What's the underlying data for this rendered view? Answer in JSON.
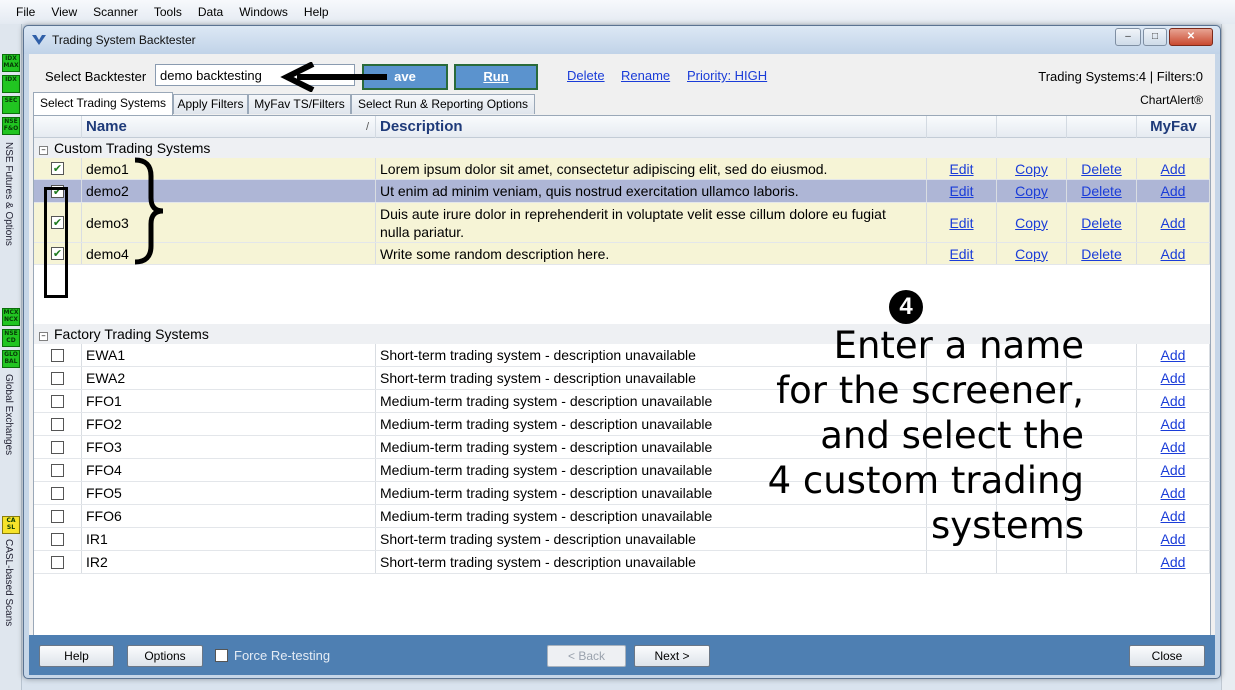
{
  "app_menu": [
    "File",
    "View",
    "Scanner",
    "Tools",
    "Data",
    "Windows",
    "Help"
  ],
  "sidebar": {
    "buttons_top": [
      "IDX\nMAX",
      "IDX",
      "SEC",
      "NSE\nF&O"
    ],
    "label_top": "NSE Futures & Options",
    "buttons_mid": [
      "MCX\nNCX",
      "NSE\nCD",
      "GLO\nBAL"
    ],
    "label_mid": "Global Exchanges",
    "buttons_bottom": [
      "CA\nSL"
    ],
    "label_bottom": "CASL-based Scans"
  },
  "window": {
    "title": "Trading System Backtester",
    "minimize": "–",
    "maximize": "□",
    "close": "✕"
  },
  "toolbar": {
    "select_label": "Select Backtester",
    "name_value": "demo backtesting",
    "save_label": "ave",
    "run_label": "Run",
    "delete_link": "Delete",
    "rename_link": "Rename",
    "priority_link": "Priority: HIGH",
    "status": "Trading Systems:4 | Filters:0",
    "brand": "ChartAlert®"
  },
  "tabs": [
    "Select Trading Systems",
    "Apply Filters",
    "MyFav TS/Filters",
    "Select Run & Reporting Options"
  ],
  "grid": {
    "headers": {
      "name": "Name",
      "sort_mark": "/",
      "description": "Description",
      "myfav": "MyFav"
    },
    "groups": {
      "custom": "Custom Trading Systems",
      "factory": "Factory Trading Systems",
      "expander": "–"
    },
    "custom_rows": [
      {
        "checked": true,
        "name": "demo1",
        "description": "Lorem ipsum dolor sit amet, consectetur adipiscing elit, sed do eiusmod.",
        "edit": "Edit",
        "copy": "Copy",
        "delete": "Delete",
        "fav": "Add"
      },
      {
        "checked": true,
        "name": "demo2",
        "description": "Ut enim ad minim veniam, quis nostrud exercitation ullamco laboris.",
        "edit": "Edit",
        "copy": "Copy",
        "delete": "Delete",
        "fav": "Add"
      },
      {
        "checked": true,
        "name": "demo3",
        "description": "Duis aute irure dolor in reprehenderit in voluptate velit esse cillum dolore eu fugiat nulla pariatur.",
        "edit": "Edit",
        "copy": "Copy",
        "delete": "Delete",
        "fav": "Add"
      },
      {
        "checked": true,
        "name": "demo4",
        "description": "Write some random description here.",
        "edit": "Edit",
        "copy": "Copy",
        "delete": "Delete",
        "fav": "Add"
      }
    ],
    "factory_rows": [
      {
        "checked": false,
        "name": "EWA1",
        "description": "Short-term trading system - description unavailable",
        "fav": "Add"
      },
      {
        "checked": false,
        "name": "EWA2",
        "description": "Short-term trading system - description unavailable",
        "fav": "Add"
      },
      {
        "checked": false,
        "name": "FFO1",
        "description": "Medium-term trading system - description unavailable",
        "fav": "Add"
      },
      {
        "checked": false,
        "name": "FFO2",
        "description": "Medium-term trading system - description unavailable",
        "fav": "Add"
      },
      {
        "checked": false,
        "name": "FFO3",
        "description": "Medium-term trading system - description unavailable",
        "fav": "Add"
      },
      {
        "checked": false,
        "name": "FFO4",
        "description": "Medium-term trading system - description unavailable",
        "fav": "Add"
      },
      {
        "checked": false,
        "name": "FFO5",
        "description": "Medium-term trading system - description unavailable",
        "fav": "Add"
      },
      {
        "checked": false,
        "name": "FFO6",
        "description": "Medium-term trading system - description unavailable",
        "fav": "Add"
      },
      {
        "checked": false,
        "name": "IR1",
        "description": "Short-term trading system - description unavailable",
        "fav": "Add"
      },
      {
        "checked": false,
        "name": "IR2",
        "description": "Short-term trading system - description unavailable",
        "fav": "Add"
      }
    ]
  },
  "annotation": {
    "step_number": "4",
    "lines": [
      "Enter a name",
      "for the screener,",
      "and select the",
      "4 custom trading",
      "systems"
    ]
  },
  "footer": {
    "help": "Help",
    "options": "Options",
    "force_retest": "Force Re-testing",
    "back": "< Back",
    "next": "Next >",
    "close": "Close"
  },
  "colors": {
    "accent_blue": "#4e7fb2",
    "custom_row": "#f6f4d6",
    "selected_row": "#aeb6d6",
    "link": "#1a3cd8"
  }
}
